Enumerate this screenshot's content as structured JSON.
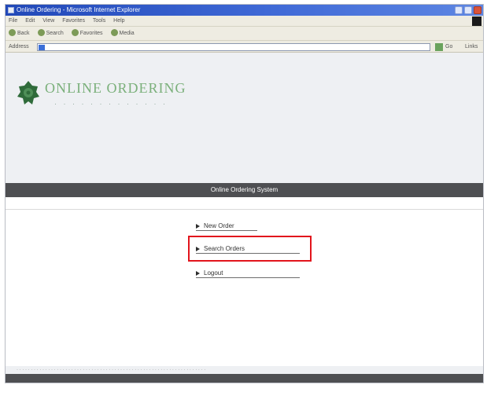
{
  "window": {
    "title": "Online Ordering - Microsoft Internet Explorer"
  },
  "menubar": {
    "items": [
      "File",
      "Edit",
      "View",
      "Favorites",
      "Tools",
      "Help"
    ]
  },
  "toolbar": {
    "back_label": "Back",
    "search_label": "Search",
    "favorites_label": "Favorites",
    "media_label": "Media"
  },
  "addressbar": {
    "label": "Address",
    "url": "",
    "go_label": "Go",
    "links_label": "Links"
  },
  "logo": {
    "title": "ONLINE ORDERING"
  },
  "navbar": {
    "title": "Online Ordering System"
  },
  "menu": {
    "items": [
      {
        "label": "New Order"
      },
      {
        "label": "Search Orders"
      },
      {
        "label": "Logout"
      }
    ]
  },
  "colors": {
    "nav_bar": "#4e4f52",
    "highlight": "#e2141c",
    "logo_green": "#7bb07b"
  }
}
